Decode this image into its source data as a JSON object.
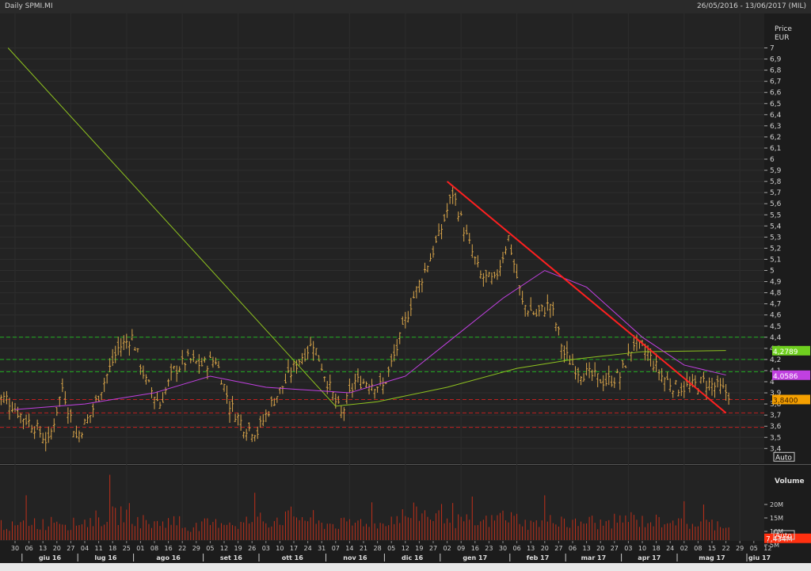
{
  "header": {
    "title": "Daily SPMI.MI",
    "range": "26/05/2016 - 13/06/2017 (MIL)"
  },
  "colors": {
    "bar": "#d9a54a",
    "ma_short": "#c040e0",
    "ma_long": "#8fc31f",
    "trend": "#ff2020",
    "support": "#c02020",
    "resist": "#20b020",
    "volume": "#c0301a"
  },
  "chart_data": [
    {
      "type": "bar",
      "title": "Daily SPMI.MI",
      "ylabel": "Price",
      "yunit": "EUR",
      "ylim": [
        3.4,
        7
      ],
      "yticks": [
        "3,4",
        "3,5",
        "3,6",
        "3,7",
        "3,8",
        "3,9",
        "4",
        "4,1",
        "4,2",
        "4,3",
        "4,4",
        "4,5",
        "4,6",
        "4,7",
        "4,8",
        "4,9",
        "5",
        "5,1",
        "5,2",
        "5,3",
        "5,4",
        "5,5",
        "5,6",
        "5,7",
        "5,8",
        "5,9",
        "6",
        "6,1",
        "6,2",
        "6,3",
        "6,4",
        "6,5",
        "6,6",
        "6,7",
        "6,8",
        "6,9",
        "7"
      ],
      "weekly_close": [
        3.85,
        3.7,
        3.6,
        3.45,
        3.95,
        3.5,
        3.7,
        4.0,
        4.3,
        4.4,
        4.0,
        3.8,
        4.1,
        4.2,
        4.15,
        4.2,
        3.8,
        3.6,
        3.55,
        3.8,
        4.0,
        4.2,
        4.35,
        4.0,
        3.7,
        4.0,
        4.0,
        3.95,
        4.3,
        4.7,
        5.0,
        5.3,
        5.7,
        5.3,
        4.95,
        4.9,
        5.3,
        4.7,
        4.6,
        4.7,
        4.25,
        4.1,
        4.05,
        4.0,
        4.05,
        4.35,
        4.25,
        4.05,
        3.95,
        3.95,
        4.0,
        3.95,
        3.88
      ],
      "ma_short": [
        [
          0,
          3.75
        ],
        [
          5,
          3.8
        ],
        [
          10,
          3.9
        ],
        [
          14,
          4.05
        ],
        [
          18,
          3.95
        ],
        [
          24,
          3.9
        ],
        [
          28,
          4.05
        ],
        [
          31,
          4.35
        ],
        [
          35,
          4.75
        ],
        [
          38,
          5.0
        ],
        [
          41,
          4.85
        ],
        [
          45,
          4.4
        ],
        [
          48,
          4.15
        ],
        [
          51,
          4.06
        ]
      ],
      "ma_long": [
        [
          -0.5,
          7.0
        ],
        [
          23,
          3.78
        ],
        [
          26,
          3.82
        ],
        [
          31,
          3.95
        ],
        [
          36,
          4.12
        ],
        [
          40,
          4.2
        ],
        [
          45,
          4.27
        ],
        [
          51,
          4.28
        ]
      ],
      "trendline": [
        [
          31,
          5.8
        ],
        [
          51,
          3.72
        ]
      ],
      "resistance_levels": [
        4.4,
        4.2,
        4.09
      ],
      "support_levels": [
        3.84,
        3.72,
        3.59
      ],
      "labels": [
        {
          "text": "4,2789",
          "value": 4.2789,
          "color": "#6fcf1f"
        },
        {
          "text": "4,0586",
          "value": 4.0586,
          "color": "#c040e0"
        },
        {
          "text": "3,8400",
          "value": 3.84,
          "color": "#f5a000"
        }
      ],
      "auto_label": "Auto"
    },
    {
      "type": "bar",
      "title": "Volume",
      "ylim": [
        0,
        24
      ],
      "yticks": [
        "5M",
        "10M",
        "15M",
        "20M"
      ],
      "weekly_avg_volume_m": [
        6,
        5,
        7,
        6,
        8,
        6,
        7,
        8,
        9,
        10,
        7,
        6,
        7,
        5,
        5,
        6,
        7,
        6,
        7,
        7,
        8,
        9,
        8,
        6,
        6,
        6,
        7,
        6,
        8,
        9,
        10,
        9,
        10,
        7,
        6,
        7,
        9,
        8,
        6,
        7,
        8,
        6,
        7,
        6,
        7,
        8,
        7,
        7,
        8,
        6,
        6,
        6,
        6
      ],
      "last_label": "7,434M",
      "auto_label": "Auto"
    }
  ],
  "xaxis": {
    "ticks": [
      "30",
      "06",
      "13",
      "20",
      "27",
      "04",
      "11",
      "18",
      "25",
      "01",
      "08",
      "16",
      "22",
      "29",
      "05",
      "12",
      "19",
      "26",
      "03",
      "10",
      "17",
      "24",
      "31",
      "07",
      "14",
      "21",
      "28",
      "05",
      "12",
      "19",
      "27",
      "02",
      "09",
      "16",
      "23",
      "30",
      "06",
      "13",
      "20",
      "27",
      "06",
      "13",
      "20",
      "27",
      "03",
      "10",
      "18",
      "24",
      "02",
      "08",
      "15",
      "22",
      "29",
      "05",
      "12"
    ],
    "months": [
      {
        "label": "giu 16",
        "start": 0.5
      },
      {
        "label": "lug 16",
        "start": 4.5
      },
      {
        "label": "ago 16",
        "start": 8.5
      },
      {
        "label": "set 16",
        "start": 13.5
      },
      {
        "label": "ott 16",
        "start": 17.5
      },
      {
        "label": "nov 16",
        "start": 22.3
      },
      {
        "label": "dic 16",
        "start": 26.5
      },
      {
        "label": "gen 17",
        "start": 30.5
      },
      {
        "label": "feb 17",
        "start": 35.5
      },
      {
        "label": "mar 17",
        "start": 39.5
      },
      {
        "label": "apr 17",
        "start": 43.5
      },
      {
        "label": "mag 17",
        "start": 47.5
      },
      {
        "label": "giu 17",
        "start": 52.5
      }
    ]
  }
}
